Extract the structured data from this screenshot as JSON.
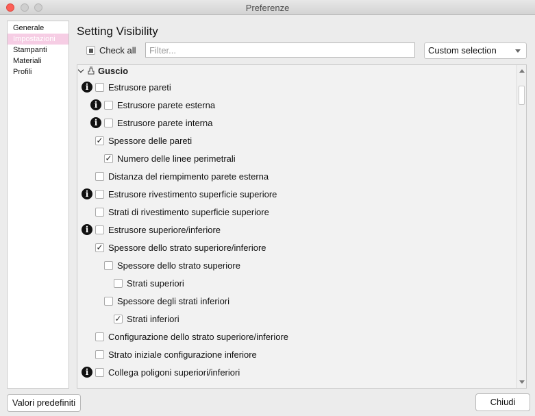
{
  "window": {
    "title": "Preferenze"
  },
  "sidebar": {
    "items": [
      {
        "label": "Generale",
        "selected": false
      },
      {
        "label": "Impostazioni",
        "selected": true
      },
      {
        "label": "Stampanti",
        "selected": false
      },
      {
        "label": "Materiali",
        "selected": false
      },
      {
        "label": "Profili",
        "selected": false
      }
    ]
  },
  "main": {
    "heading": "Setting Visibility",
    "check_all_label": "Check all",
    "filter_placeholder": "Filter...",
    "filter_value": "",
    "selection_value": "Custom selection"
  },
  "settings": {
    "category": "Guscio",
    "items": [
      {
        "label": "Estrusore pareti",
        "checked": false,
        "info": true,
        "indent": 0
      },
      {
        "label": "Estrusore parete esterna",
        "checked": false,
        "info": true,
        "indent": 1
      },
      {
        "label": "Estrusore parete interna",
        "checked": false,
        "info": true,
        "indent": 1
      },
      {
        "label": "Spessore delle pareti",
        "checked": true,
        "info": false,
        "indent": 0
      },
      {
        "label": "Numero delle linee perimetrali",
        "checked": true,
        "info": false,
        "indent": 1
      },
      {
        "label": "Distanza del riempimento parete esterna",
        "checked": false,
        "info": false,
        "indent": 0
      },
      {
        "label": "Estrusore rivestimento superficie superiore",
        "checked": false,
        "info": true,
        "indent": 0
      },
      {
        "label": "Strati di rivestimento superficie superiore",
        "checked": false,
        "info": false,
        "indent": 0
      },
      {
        "label": "Estrusore superiore/inferiore",
        "checked": false,
        "info": true,
        "indent": 0
      },
      {
        "label": "Spessore dello strato superiore/inferiore",
        "checked": true,
        "info": false,
        "indent": 0
      },
      {
        "label": "Spessore dello strato superiore",
        "checked": false,
        "info": false,
        "indent": 1
      },
      {
        "label": "Strati superiori",
        "checked": false,
        "info": false,
        "indent": 2
      },
      {
        "label": "Spessore degli strati inferiori",
        "checked": false,
        "info": false,
        "indent": 1
      },
      {
        "label": "Strati inferiori",
        "checked": true,
        "info": false,
        "indent": 2
      },
      {
        "label": "Configurazione dello strato superiore/inferiore",
        "checked": false,
        "info": false,
        "indent": 0
      },
      {
        "label": "Strato iniziale configurazione inferiore",
        "checked": false,
        "info": false,
        "indent": 0
      },
      {
        "label": "Collega poligoni superiori/inferiori",
        "checked": false,
        "info": true,
        "indent": 0
      }
    ]
  },
  "footer": {
    "defaults_label": "Valori predefiniti",
    "close_label": "Chiudi"
  },
  "icons": {
    "info": "info-icon",
    "category": "shell-icon",
    "expand": "chevron-down-icon",
    "dropdown": "dropdown-arrow-icon"
  }
}
